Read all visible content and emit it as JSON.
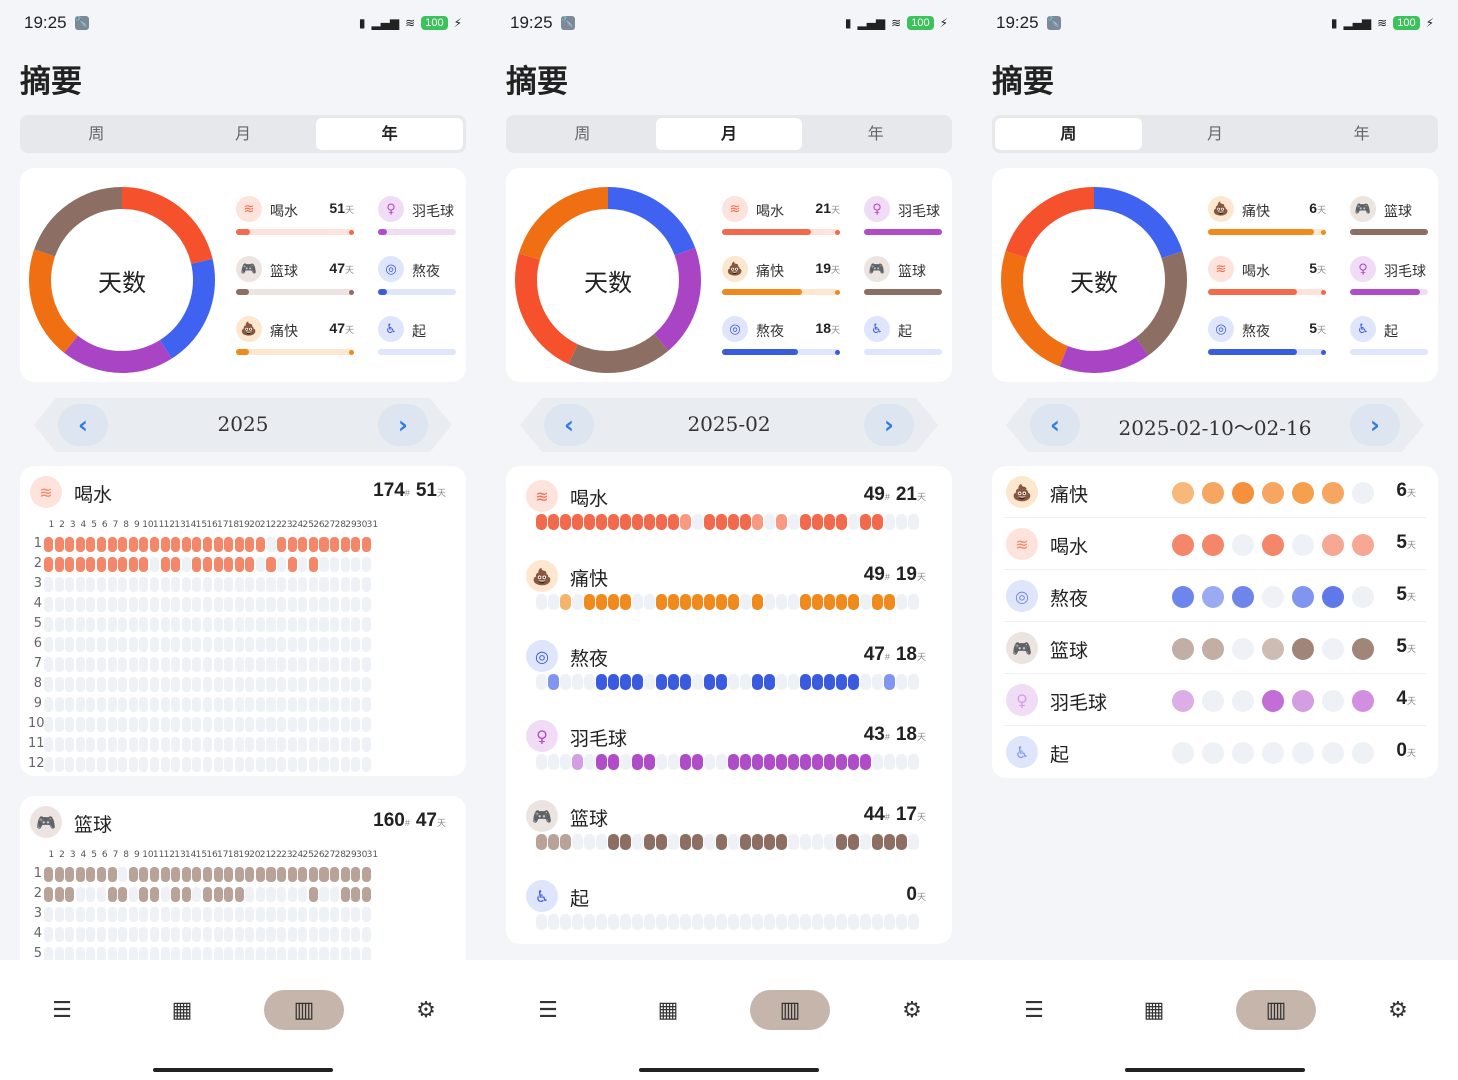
{
  "status": {
    "time": "19:25",
    "battery": "100"
  },
  "colors": {
    "drink": "#f26a4b",
    "drink_light": "#f79a80",
    "poop": "#f08a1c",
    "poop_light": "#f6b36a",
    "night": "#3a5be0",
    "night_light": "#7f95ef",
    "badminton": "#b14cc8",
    "badminton_light": "#d59de2",
    "basketball": "#8d6e63",
    "basketball_light": "#b9a398",
    "empty": "#eef1f6"
  },
  "tabbar": {
    "items": [
      "list-icon",
      "calendar-icon",
      "chart-icon",
      "settings-icon"
    ],
    "active": 2
  },
  "screens": [
    {
      "title": "摘要",
      "segments": [
        "周",
        "月",
        "年"
      ],
      "active_segment": 2,
      "donut_label": "天数",
      "donut": [
        {
          "key": "drink",
          "color": "#f4512c",
          "value": 51
        },
        {
          "key": "night",
          "color": "#3f63f0",
          "value": 47
        },
        {
          "key": "badminton",
          "color": "#a944c4",
          "value": 47
        },
        {
          "key": "poop",
          "color": "#f06f12",
          "value": 47
        },
        {
          "key": "basketball",
          "color": "#8d6e63",
          "value": 47
        }
      ],
      "legend": [
        {
          "name": "喝水",
          "icon": "≋",
          "value": "51",
          "unit": "天",
          "color": "#f26a4b",
          "bg": "#fde3dc",
          "fill": 0.12
        },
        {
          "name": "羽毛球",
          "icon": "♀",
          "value": "",
          "unit": "",
          "color": "#b14cc8",
          "bg": "#f1dcf5",
          "fill": 0.12
        },
        {
          "name": "篮球",
          "icon": "🎮",
          "value": "47",
          "unit": "天",
          "color": "#8d6e63",
          "bg": "#ece4e0",
          "fill": 0.11
        },
        {
          "name": "熬夜",
          "icon": "◎",
          "value": "",
          "unit": "",
          "color": "#3a5be0",
          "bg": "#dfe5fb",
          "fill": 0.11
        },
        {
          "name": "痛快",
          "icon": "💩",
          "value": "47",
          "unit": "天",
          "color": "#f08a1c",
          "bg": "#fde7cf",
          "fill": 0.11
        },
        {
          "name": "起",
          "icon": "♿",
          "value": "",
          "unit": "",
          "color": "#3a5be0",
          "bg": "#dfe5fb",
          "fill": 0
        }
      ],
      "period": "2025",
      "habits": [
        {
          "name": "喝水",
          "icon": "≋",
          "times": "174",
          "times_unit": "#",
          "days": "51",
          "days_unit": "天",
          "color": "#f4866a",
          "bg": "#fde3dc",
          "months": [
            "1111111111111111111110111111111111",
            "1111111111011011111101010100000000"
          ]
        },
        {
          "name": "篮球",
          "icon": "🎮",
          "times": "160",
          "times_unit": "#",
          "days": "47",
          "days_unit": "天",
          "color": "#b9a398",
          "bg": "#ece4e0",
          "months": [
            "1111111011111111111111111111111111",
            "1110001101101101111000000100111000"
          ]
        }
      ],
      "day_labels": [
        "1",
        "2",
        "3",
        "4",
        "5",
        "6",
        "7",
        "8",
        "9",
        "10",
        "11",
        "12",
        "13",
        "14",
        "15",
        "16",
        "17",
        "18",
        "19",
        "20",
        "21",
        "22",
        "23",
        "24",
        "25",
        "26",
        "27",
        "28",
        "29",
        "30",
        "31"
      ],
      "month_labels": [
        "1",
        "2",
        "3",
        "4",
        "5",
        "6",
        "7",
        "8",
        "9",
        "10",
        "11",
        "12"
      ]
    },
    {
      "title": "摘要",
      "segments": [
        "周",
        "月",
        "年"
      ],
      "active_segment": 1,
      "donut_label": "天数",
      "donut": [
        {
          "key": "night",
          "color": "#3f63f0",
          "value": 18
        },
        {
          "key": "badminton",
          "color": "#a944c4",
          "value": 18
        },
        {
          "key": "basketball",
          "color": "#8d6e63",
          "value": 17
        },
        {
          "key": "drink",
          "color": "#f4512c",
          "value": 21
        },
        {
          "key": "poop",
          "color": "#f06f12",
          "value": 19
        }
      ],
      "legend": [
        {
          "name": "喝水",
          "icon": "≋",
          "value": "21",
          "unit": "天",
          "color": "#f26a4b",
          "bg": "#fde3dc",
          "fill": 0.75
        },
        {
          "name": "羽毛球",
          "icon": "♀",
          "value": "",
          "unit": "",
          "color": "#b14cc8",
          "bg": "#f1dcf5",
          "fill": 1
        },
        {
          "name": "痛快",
          "icon": "💩",
          "value": "19",
          "unit": "天",
          "color": "#f08a1c",
          "bg": "#fde7cf",
          "fill": 0.68
        },
        {
          "name": "篮球",
          "icon": "🎮",
          "value": "",
          "unit": "",
          "color": "#8d6e63",
          "bg": "#ece4e0",
          "fill": 1
        },
        {
          "name": "熬夜",
          "icon": "◎",
          "value": "18",
          "unit": "天",
          "color": "#3a5be0",
          "bg": "#dfe5fb",
          "fill": 0.64
        },
        {
          "name": "起",
          "icon": "♿",
          "value": "",
          "unit": "",
          "color": "#3a5be0",
          "bg": "#dfe5fb",
          "fill": 0
        }
      ],
      "period": "2025-02",
      "habits": [
        {
          "name": "喝水",
          "icon": "≋",
          "times": "49",
          "times_unit": "#",
          "days": "21",
          "days_unit": "天",
          "color": "#f26a4b",
          "light": "#f79a80",
          "bg": "#fde3dc",
          "pattern": "2222222222221022221010222202200000000"
        },
        {
          "name": "痛快",
          "icon": "💩",
          "times": "49",
          "times_unit": "#",
          "days": "19",
          "days_unit": "天",
          "color": "#f08a1c",
          "light": "#f6b36a",
          "bg": "#fde7cf",
          "pattern": "0010222200222222202000222220220000000"
        },
        {
          "name": "熬夜",
          "icon": "◎",
          "times": "47",
          "times_unit": "#",
          "days": "18",
          "days_unit": "天",
          "color": "#3a5be0",
          "light": "#7f95ef",
          "bg": "#dfe5fb",
          "pattern": "0100022220222022002200222220010000000"
        },
        {
          "name": "羽毛球",
          "icon": "♀",
          "times": "43",
          "times_unit": "#",
          "days": "18",
          "days_unit": "天",
          "color": "#b14cc8",
          "light": "#d59de2",
          "bg": "#f1dcf5",
          "pattern": "0001022022002200222222222222000000000"
        },
        {
          "name": "篮球",
          "icon": "🎮",
          "times": "44",
          "times_unit": "#",
          "days": "17",
          "days_unit": "天",
          "color": "#8d6e63",
          "light": "#b9a398",
          "bg": "#ece4e0",
          "pattern": "1110002202202202022220000220222000000"
        },
        {
          "name": "起",
          "icon": "♿",
          "times": "",
          "times_unit": "",
          "days": "0",
          "days_unit": "天",
          "color": "#3a5be0",
          "light": "#7f95ef",
          "bg": "#dfe5fb",
          "pattern": "0000000000000000000000000000000000000"
        }
      ]
    },
    {
      "title": "摘要",
      "segments": [
        "周",
        "月",
        "年"
      ],
      "active_segment": 0,
      "donut_label": "天数",
      "donut": [
        {
          "key": "night",
          "color": "#3f63f0",
          "value": 5
        },
        {
          "key": "basketball",
          "color": "#8d6e63",
          "value": 5
        },
        {
          "key": "badminton",
          "color": "#a944c4",
          "value": 4
        },
        {
          "key": "poop",
          "color": "#f06f12",
          "value": 6
        },
        {
          "key": "drink",
          "color": "#f4512c",
          "value": 5
        }
      ],
      "legend": [
        {
          "name": "痛快",
          "icon": "💩",
          "value": "6",
          "unit": "天",
          "color": "#f08a1c",
          "bg": "#fde7cf",
          "fill": 0.9
        },
        {
          "name": "篮球",
          "icon": "🎮",
          "value": "",
          "unit": "",
          "color": "#8d6e63",
          "bg": "#ece4e0",
          "fill": 1
        },
        {
          "name": "喝水",
          "icon": "≋",
          "value": "5",
          "unit": "天",
          "color": "#f26a4b",
          "bg": "#fde3dc",
          "fill": 0.75
        },
        {
          "name": "羽毛球",
          "icon": "♀",
          "value": "",
          "unit": "",
          "color": "#b14cc8",
          "bg": "#f1dcf5",
          "fill": 0.9
        },
        {
          "name": "熬夜",
          "icon": "◎",
          "value": "5",
          "unit": "天",
          "color": "#3a5be0",
          "bg": "#dfe5fb",
          "fill": 0.75
        },
        {
          "name": "起",
          "icon": "♿",
          "value": "",
          "unit": "",
          "color": "#3a5be0",
          "bg": "#dfe5fb",
          "fill": 0
        }
      ],
      "period": "2025-02-10～02-16",
      "habits": [
        {
          "name": "痛快",
          "icon": "💩",
          "count": "6",
          "unit": "天",
          "color": "#f6b36a",
          "bg": "#fde7cf",
          "week": [
            1,
            1,
            1,
            1,
            1,
            1,
            0
          ],
          "shades": [
            "#f8b87a",
            "#f6a660",
            "#f5913d",
            "#f6a660",
            "#f5a04f",
            "#f6a660"
          ]
        },
        {
          "name": "喝水",
          "icon": "≋",
          "count": "5",
          "unit": "天",
          "color": "#f4866a",
          "bg": "#fde3dc",
          "week": [
            1,
            1,
            0,
            1,
            0,
            1,
            1
          ],
          "shades": [
            "#f4866a",
            "#f4866a",
            "",
            "#f4866a",
            "",
            "#f7a894",
            "#f7a894"
          ]
        },
        {
          "name": "熬夜",
          "icon": "◎",
          "count": "5",
          "unit": "天",
          "color": "#6e86ec",
          "bg": "#dfe5fb",
          "week": [
            1,
            1,
            1,
            0,
            1,
            1,
            0
          ],
          "shades": [
            "#6e86ec",
            "#9aabf2",
            "#6e86ec",
            "",
            "#7f95ef",
            "#5f78ea",
            ""
          ]
        },
        {
          "name": "篮球",
          "icon": "🎮",
          "count": "5",
          "unit": "天",
          "color": "#b9a398",
          "bg": "#ece4e0",
          "week": [
            1,
            1,
            0,
            1,
            1,
            0,
            1
          ],
          "shades": [
            "#c2aea4",
            "#c2aea4",
            "",
            "#cdbcb3",
            "#a08579",
            "",
            "#a08579"
          ]
        },
        {
          "name": "羽毛球",
          "icon": "♀",
          "count": "4",
          "unit": "天",
          "color": "#d59de2",
          "bg": "#f1dcf5",
          "week": [
            1,
            0,
            0,
            1,
            1,
            0,
            1
          ],
          "shades": [
            "#dcaee6",
            "",
            "",
            "#c26ed6",
            "#d59de2",
            "",
            "#d28ee0"
          ]
        },
        {
          "name": "起",
          "icon": "♿",
          "count": "0",
          "unit": "天",
          "color": "#7f95ef",
          "bg": "#dfe5fb",
          "week": [
            0,
            0,
            0,
            0,
            0,
            0,
            0
          ],
          "shades": []
        }
      ]
    }
  ]
}
